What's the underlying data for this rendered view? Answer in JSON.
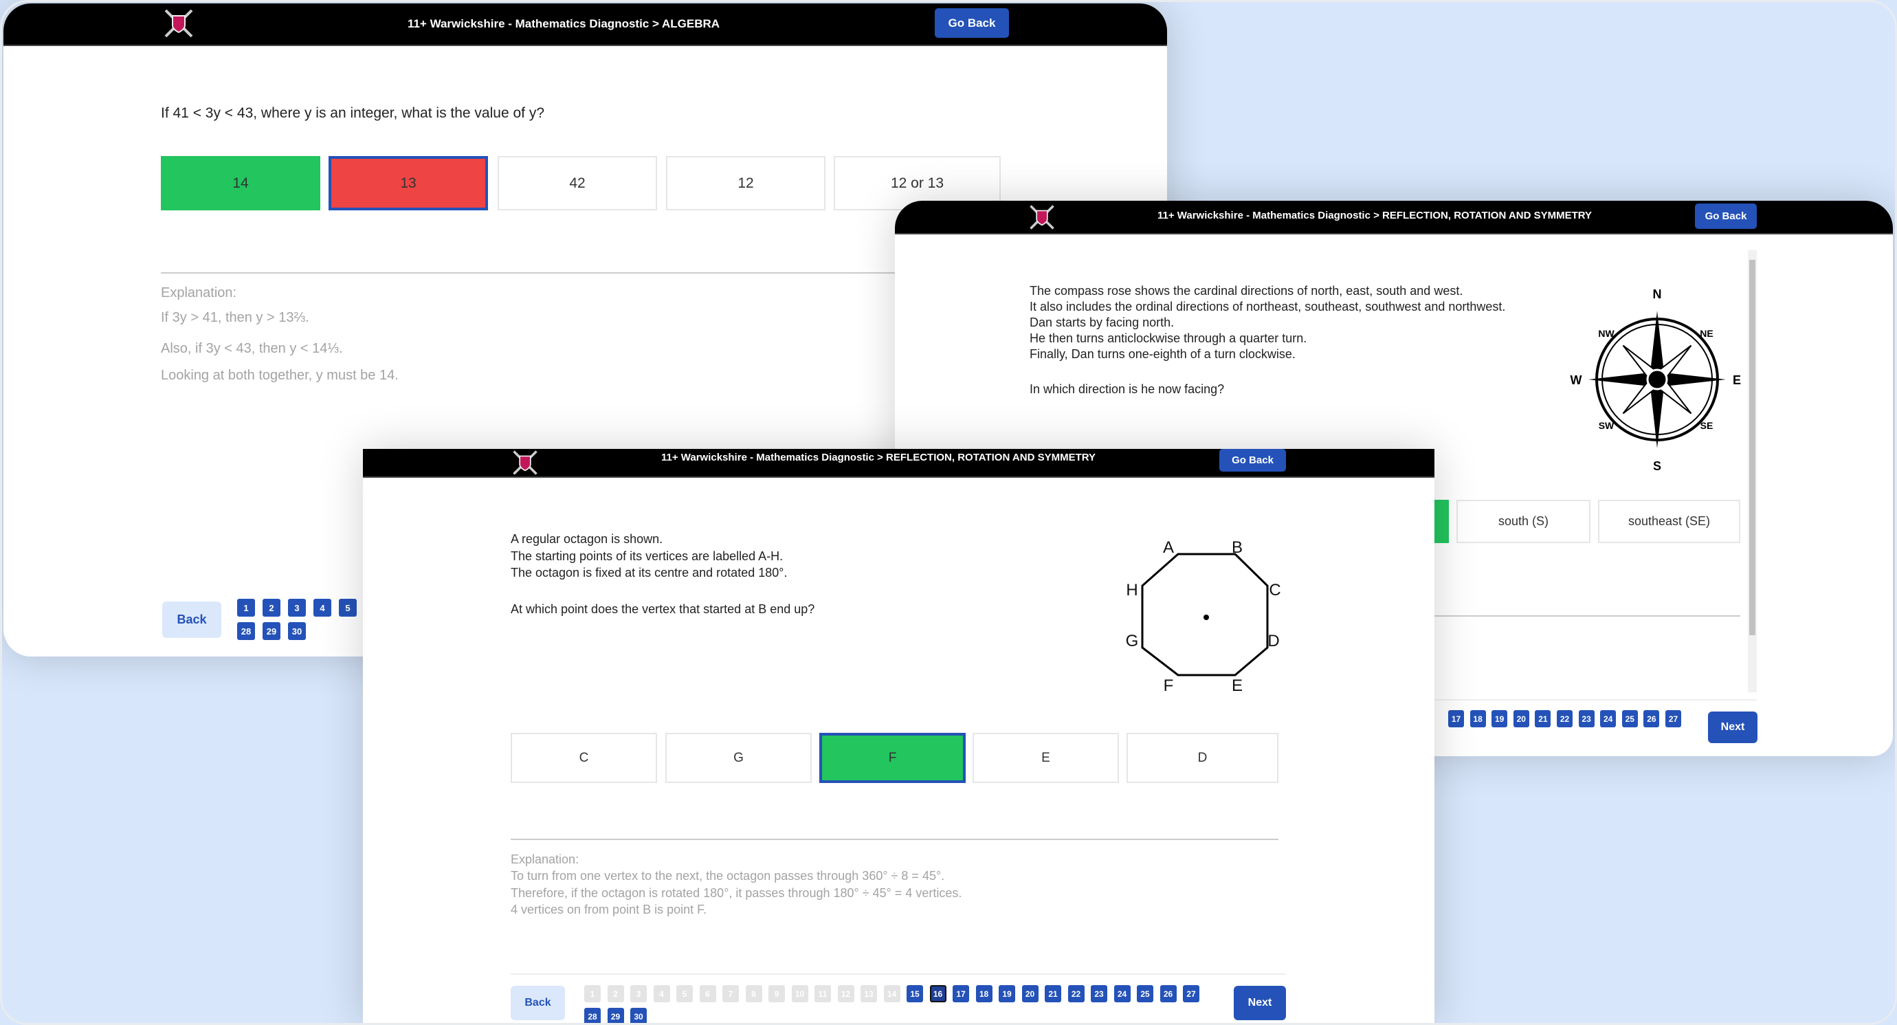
{
  "colors": {
    "accent": "#2452b8",
    "correct": "#22c55e",
    "wrong": "#ef4444",
    "background": "#d7e6fb"
  },
  "window1": {
    "title": "11+ Warwickshire - Mathematics Diagnostic > ALGEBRA",
    "go_back": "Go Back",
    "question": "If 41 < 3y < 43, where y is an integer, what is the value of y?",
    "options": [
      {
        "label": "14",
        "state": "correct"
      },
      {
        "label": "13",
        "state": "wrong-selected"
      },
      {
        "label": "42",
        "state": ""
      },
      {
        "label": "12",
        "state": ""
      },
      {
        "label": "12 or 13",
        "state": ""
      }
    ],
    "explanation": [
      "Explanation:",
      "If 3y > 41, then y > 13⅔.",
      "Also, if 3y < 43, then y < 14⅓.",
      "Looking at both together, y must be 14."
    ],
    "back": "Back",
    "pages_row1": [
      "1",
      "2",
      "3",
      "4",
      "5"
    ],
    "pages_row2": [
      "28",
      "29",
      "30"
    ]
  },
  "window2": {
    "title": "11+ Warwickshire - Mathematics Diagnostic > REFLECTION, ROTATION AND SYMMETRY",
    "go_back": "Go Back",
    "question_lines": [
      "The compass rose shows the cardinal directions of north, east, south and west.",
      "It also includes the ordinal directions of northeast, southeast, southwest and northwest.",
      "Dan starts by facing north.",
      "He then turns anticlockwise through a quarter turn.",
      "Finally, Dan turns one-eighth of a turn clockwise."
    ],
    "question": "In which direction is he now facing?",
    "compass": {
      "N": "N",
      "NE": "NE",
      "E": "E",
      "SE": "SE",
      "S": "S",
      "SW": "SW",
      "W": "W",
      "NW": "NW"
    },
    "options": [
      {
        "label": "south (S)"
      },
      {
        "label": "southeast (SE)"
      }
    ],
    "pages": [
      "17",
      "18",
      "19",
      "20",
      "21",
      "22",
      "23",
      "24",
      "25",
      "26",
      "27"
    ],
    "next": "Next"
  },
  "window3": {
    "title": "11+ Warwickshire - Mathematics Diagnostic > REFLECTION, ROTATION AND SYMMETRY",
    "go_back": "Go Back",
    "question_lines": [
      "A regular octagon is shown.",
      "The starting points of its vertices are labelled A-H.",
      "The octagon is fixed at its centre and rotated 180°."
    ],
    "question": "At which point does the vertex that started at B end up?",
    "vertices": {
      "A": "A",
      "B": "B",
      "C": "C",
      "D": "D",
      "E": "E",
      "F": "F",
      "G": "G",
      "H": "H"
    },
    "options": [
      {
        "label": "C",
        "state": ""
      },
      {
        "label": "G",
        "state": ""
      },
      {
        "label": "F",
        "state": "correct-selected"
      },
      {
        "label": "E",
        "state": ""
      },
      {
        "label": "D",
        "state": ""
      }
    ],
    "explanation": [
      "Explanation:",
      "To turn from one vertex to the next, the octagon passes through 360° ÷ 8 = 45°.",
      "Therefore, if the octagon is rotated 180°, it passes through 180° ÷ 45° = 4 vertices.",
      "4 vertices on from point B is point F."
    ],
    "back": "Back",
    "next": "Next",
    "pages": [
      "1",
      "2",
      "3",
      "4",
      "5",
      "6",
      "7",
      "8",
      "9",
      "10",
      "11",
      "12",
      "13",
      "14",
      "15",
      "16",
      "17",
      "18",
      "19",
      "20",
      "21",
      "22",
      "23",
      "24",
      "25",
      "26",
      "27",
      "28",
      "29",
      "30"
    ],
    "answered_through": 14,
    "current_page": 16
  }
}
